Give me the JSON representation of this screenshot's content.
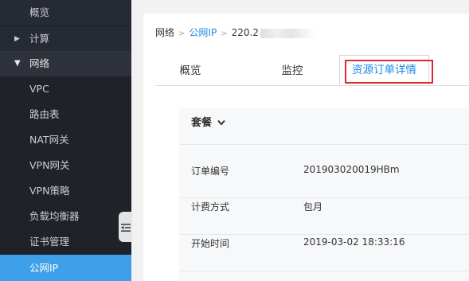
{
  "sidebar": {
    "items": [
      {
        "label": "概览"
      },
      {
        "label": "计算"
      },
      {
        "label": "网络"
      },
      {
        "label": "VPC"
      },
      {
        "label": "路由表"
      },
      {
        "label": "NAT网关"
      },
      {
        "label": "VPN网关"
      },
      {
        "label": "VPN策略"
      },
      {
        "label": "负载均衡器"
      },
      {
        "label": "证书管理"
      },
      {
        "label": "公网IP"
      }
    ],
    "active_item": "公网IP",
    "collapse_icon": "collapse-sidebar-icon"
  },
  "breadcrumb": {
    "root": "网络",
    "section": "公网IP",
    "current": "220.2",
    "separator": ">"
  },
  "tabs": [
    {
      "label": "概览"
    },
    {
      "label": "监控"
    },
    {
      "label": "资源订单详情"
    }
  ],
  "active_tab": "资源订单详情",
  "order": {
    "header": "套餐",
    "rows": [
      {
        "key": "订单编号",
        "value": "201903020019HBm"
      },
      {
        "key": "计费方式",
        "value": "包月"
      },
      {
        "key": "开始时间",
        "value": "2019-03-02 18:33:16"
      }
    ]
  },
  "colors": {
    "sidebar_bg": "#262a33",
    "active_bg": "#3ea0e8",
    "link": "#1e88e5",
    "highlight_border": "#e0282e"
  }
}
